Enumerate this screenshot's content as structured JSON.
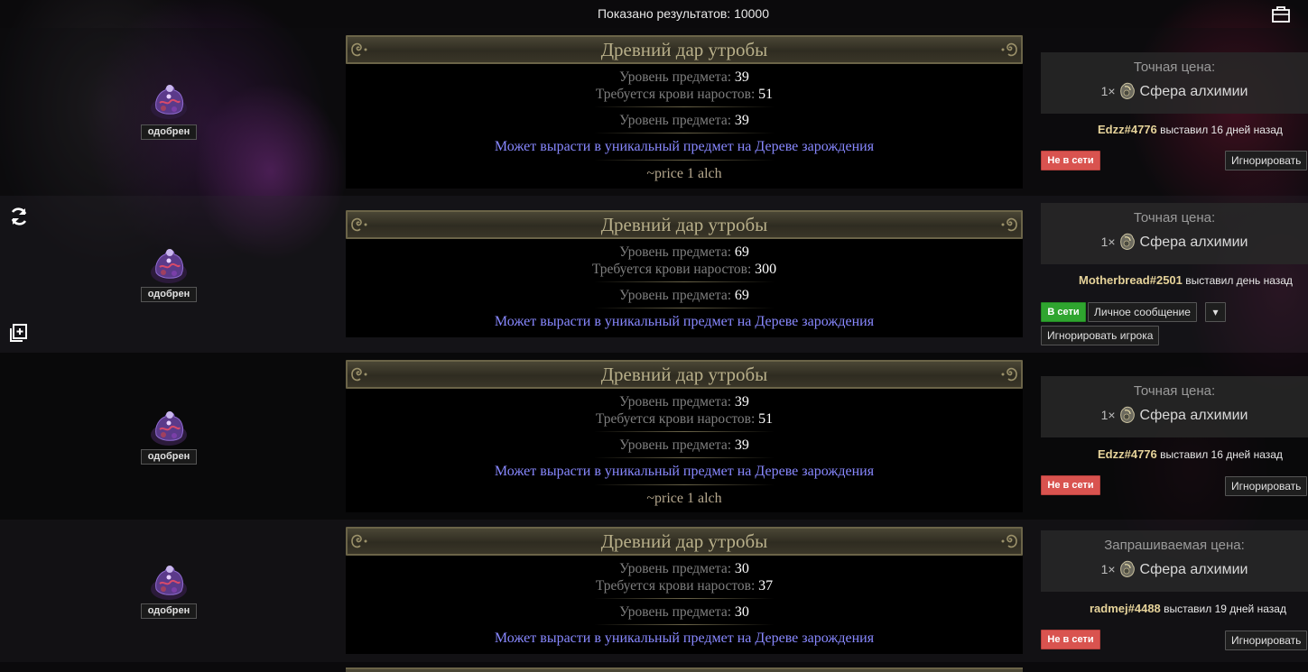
{
  "header": {
    "results_label": "Показано результатов:",
    "results_count": "10000"
  },
  "icons": {
    "top_right": "bag-icon",
    "refresh": "refresh-icon",
    "copy": "copy-icon"
  },
  "colors": {
    "title": "#b9b08a",
    "special": "#8888ff",
    "offline": "#d9534f",
    "online": "#2fa52f",
    "account": "#e6d39a"
  },
  "listings": [
    {
      "badge": "одобрен",
      "title": "Древний дар утробы",
      "item_level_label": "Уровень предмета:",
      "item_level": "39",
      "req_label": "Требуется крови наростов:",
      "req_value": "51",
      "item_level2_label": "Уровень предмета:",
      "item_level2": "39",
      "special": "Может вырасти в уникальный предмет на Дереве зарождения",
      "note": "~price 1 alch",
      "price_label": "Точная цена:",
      "price_qty": "1×",
      "currency": "Сфера алхимии",
      "account": "Edzz#4776",
      "listed": "выставил 16 дней назад",
      "status": "Не в сети",
      "ignore": "Игнорировать"
    },
    {
      "badge": "одобрен",
      "title": "Древний дар утробы",
      "item_level_label": "Уровень предмета:",
      "item_level": "69",
      "req_label": "Требуется крови наростов:",
      "req_value": "300",
      "item_level2_label": "Уровень предмета:",
      "item_level2": "69",
      "special": "Может вырасти в уникальный предмет на Дереве зарождения",
      "price_label": "Точная цена:",
      "price_qty": "1×",
      "currency": "Сфера алхимии",
      "account": "Motherbread#2501",
      "listed": "выставил день назад",
      "status": "В сети",
      "whisper": "Личное сообщение",
      "caret": "▾",
      "ignore": "Игнорировать игрока"
    },
    {
      "badge": "одобрен",
      "title": "Древний дар утробы",
      "item_level_label": "Уровень предмета:",
      "item_level": "39",
      "req_label": "Требуется крови наростов:",
      "req_value": "51",
      "item_level2_label": "Уровень предмета:",
      "item_level2": "39",
      "special": "Может вырасти в уникальный предмет на Дереве зарождения",
      "note": "~price 1 alch",
      "price_label": "Точная цена:",
      "price_qty": "1×",
      "currency": "Сфера алхимии",
      "account": "Edzz#4776",
      "listed": "выставил 16 дней назад",
      "status": "Не в сети",
      "ignore": "Игнорировать"
    },
    {
      "badge": "одобрен",
      "title": "Древний дар утробы",
      "item_level_label": "Уровень предмета:",
      "item_level": "30",
      "req_label": "Требуется крови наростов:",
      "req_value": "37",
      "item_level2_label": "Уровень предмета:",
      "item_level2": "30",
      "special": "Может вырасти в уникальный предмет на Дереве зарождения",
      "price_label": "Запрашиваемая цена:",
      "price_qty": "1×",
      "currency": "Сфера алхимии",
      "account": "radmej#4488",
      "listed": "выставил 19 дней назад",
      "status": "Не в сети",
      "ignore": "Игнорировать"
    }
  ]
}
